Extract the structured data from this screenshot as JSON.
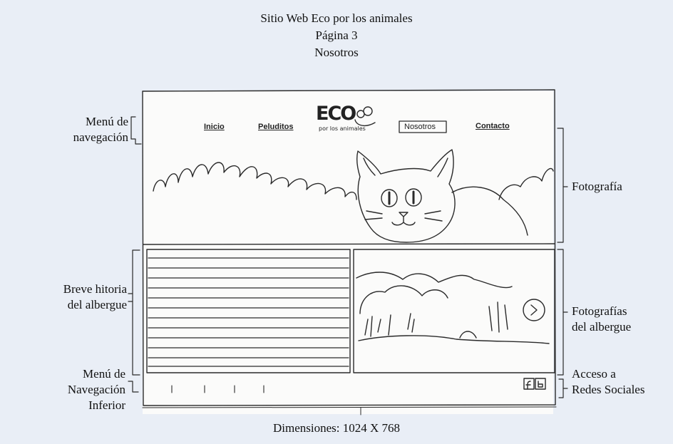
{
  "header": {
    "title": "Sitio Web Eco por los animales",
    "page": "Página 3",
    "section": "Nosotros"
  },
  "footer": {
    "dimensions": "Dimensiones: 1024 X 768"
  },
  "labels_left": {
    "menu_line1": "Menú de",
    "menu_line2": "navegación",
    "historia_line1": "Breve hitoria",
    "historia_line2": "del albergue",
    "menu_inferior_line1": "Menú de",
    "menu_inferior_line2": "Navegación",
    "menu_inferior_line3": "Inferior"
  },
  "labels_right": {
    "fotografia": "Fotografía",
    "fotos_line1": "Fotografías",
    "fotos_line2": "del albergue",
    "redes_line1": "Acceso a",
    "redes_line2": "Redes Sociales"
  },
  "sketch": {
    "nav": [
      "Inicio",
      "Peluditos",
      "Nosotros",
      "Contacto"
    ],
    "logo_text": "ECO",
    "logo_sub": "por los animales"
  }
}
